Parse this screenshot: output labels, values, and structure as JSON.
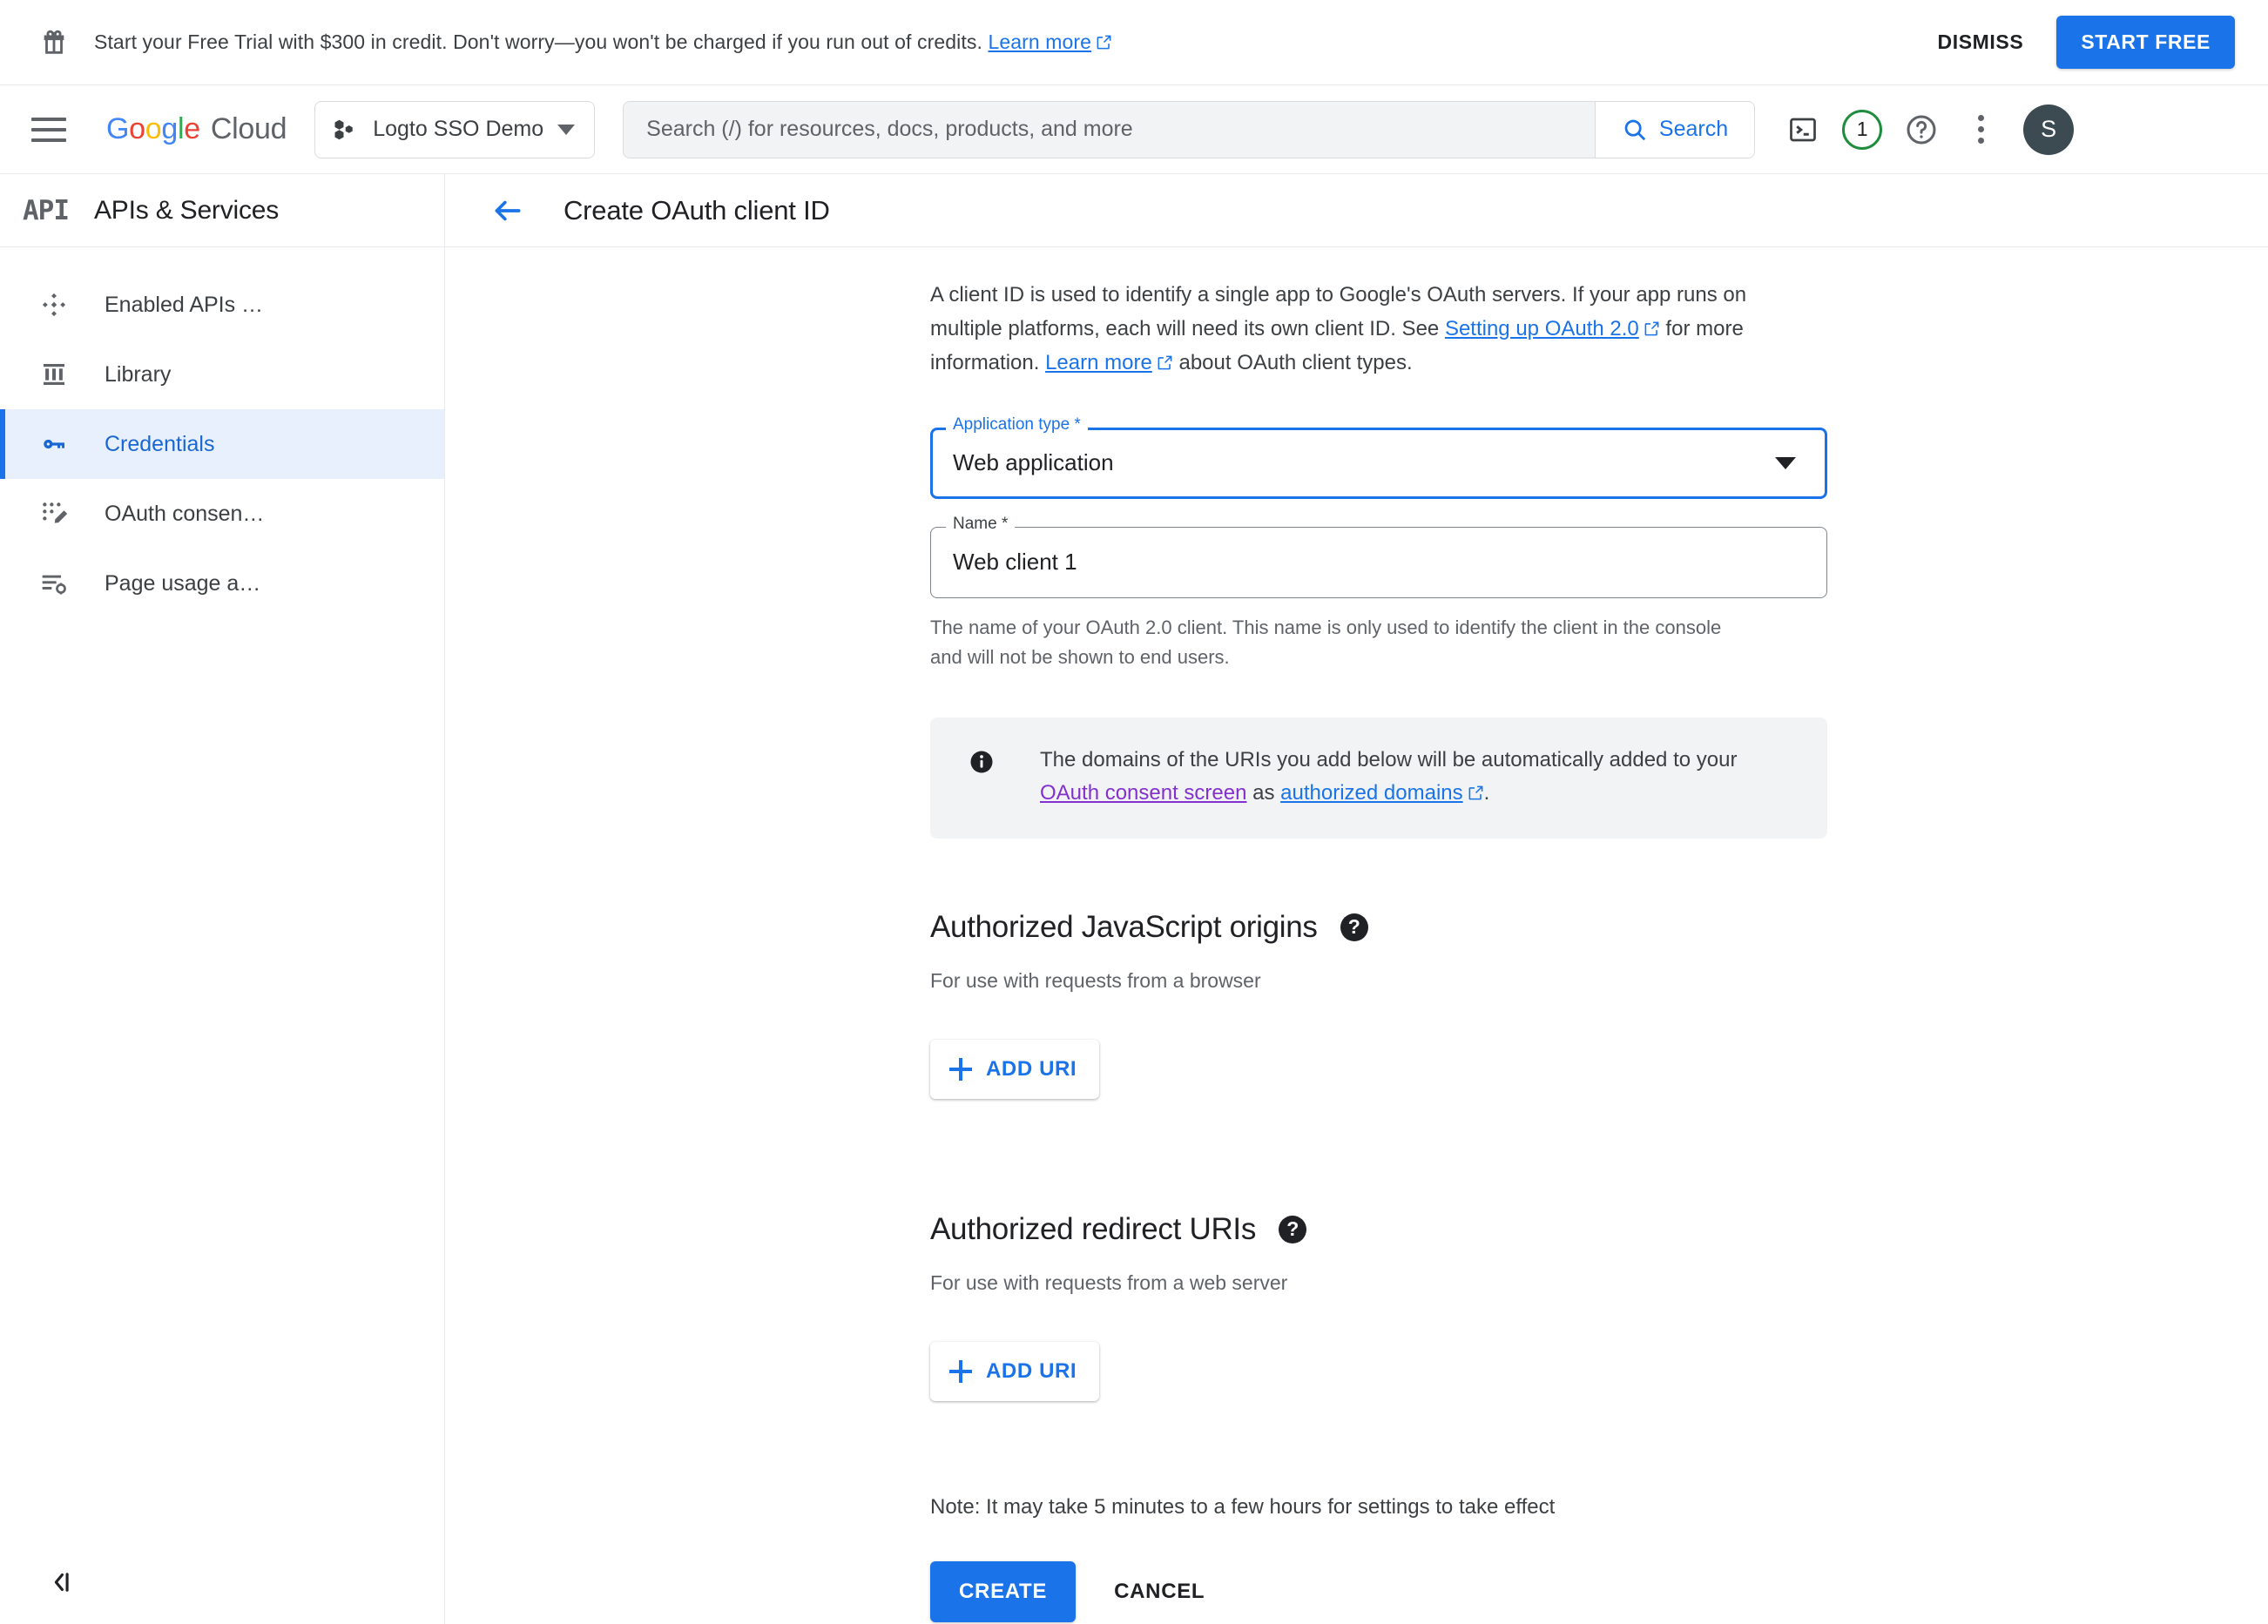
{
  "promo": {
    "icon": "gift-icon",
    "message_before_link": "Start your Free Trial with $300 in credit. Don't worry—you won't be charged if you run out of credits.",
    "learn_more_label": "Learn more",
    "dismiss_label": "DISMISS",
    "start_free_label": "START FREE"
  },
  "topbar": {
    "menu_icon": "hamburger-menu-icon",
    "brand": {
      "g1": "G",
      "g2": "o",
      "g3": "o",
      "g4": "g",
      "g5": "l",
      "g6": "e",
      "suffix": "Cloud"
    },
    "project": {
      "icon": "project-icon",
      "name": "Logto SSO Demo"
    },
    "search": {
      "placeholder": "Search (/) for resources, docs, products, and more",
      "value": "",
      "button_label": "Search",
      "icon": "search-icon"
    },
    "icons": {
      "cloud_shell": "terminal-icon",
      "notifications_count": "1",
      "notifications_accent": "#1e8e3e",
      "help": "help-circle-icon",
      "more": "more-vert-icon"
    },
    "avatar_initial": "S"
  },
  "sidebar": {
    "logo_text": "API",
    "title": "APIs & Services",
    "items": [
      {
        "label": "Enabled APIs …",
        "icon": "enabled-apis-icon",
        "active": false
      },
      {
        "label": "Library",
        "icon": "library-icon",
        "active": false
      },
      {
        "label": "Credentials",
        "icon": "key-icon",
        "active": true
      },
      {
        "label": "OAuth consen…",
        "icon": "oauth-consent-icon",
        "active": false
      },
      {
        "label": "Page usage a…",
        "icon": "page-usage-icon",
        "active": false
      }
    ],
    "collapse_icon": "collapse-panel-icon",
    "active_color": "#1967d2",
    "active_bg": "#e8f0fe"
  },
  "main": {
    "back_icon": "back-arrow-icon",
    "page_title": "Create OAuth client ID",
    "intro": {
      "part1": "A client ID is used to identify a single app to Google's OAuth servers. If your app runs on multiple platforms, each will need its own client ID. See ",
      "link1": "Setting up OAuth 2.0",
      "part2": " for more information. ",
      "link2": "Learn more",
      "part3": " about OAuth client types."
    },
    "application_type": {
      "label": "Application type *",
      "value": "Web application",
      "focused": true,
      "caret_icon": "chevron-down-icon"
    },
    "name_field": {
      "label": "Name *",
      "value": "Web client 1",
      "help": "The name of your OAuth 2.0 client. This name is only used to identify the client in the console and will not be shown to end users."
    },
    "info_box": {
      "icon": "info-icon",
      "text_part1": "The domains of the URIs you add below will be automatically added to your ",
      "link_consent": "OAuth consent screen",
      "text_part2": " as ",
      "link_domains": "authorized domains",
      "text_part3": ".",
      "consent_link_color": "#8430ce",
      "domains_link_color": "#1a73e8"
    },
    "js_origins": {
      "heading": "Authorized JavaScript origins",
      "help_icon": "help-filled-icon",
      "subtitle": "For use with requests from a browser",
      "add_label": "ADD URI",
      "add_icon": "plus-icon"
    },
    "redirect_uris": {
      "heading": "Authorized redirect URIs",
      "help_icon": "help-filled-icon",
      "subtitle": "For use with requests from a web server",
      "add_label": "ADD URI",
      "add_icon": "plus-icon"
    },
    "note": "Note: It may take 5 minutes to a few hours for settings to take effect",
    "create_label": "CREATE",
    "cancel_label": "CANCEL"
  },
  "colors": {
    "primary": "#1a73e8",
    "text": "#202124",
    "muted": "#5f6368",
    "border": "#dadce0"
  }
}
